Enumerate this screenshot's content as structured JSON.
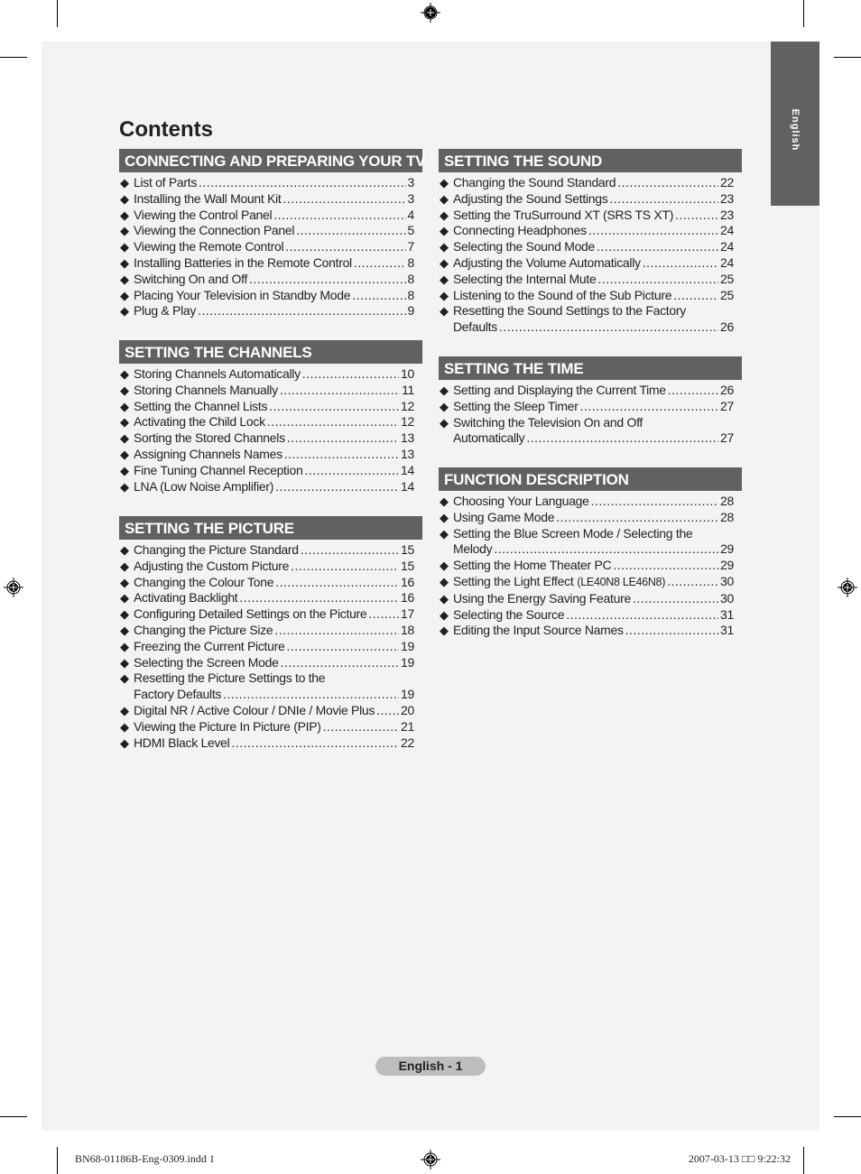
{
  "page": {
    "title": "Contents",
    "language_tab": "English",
    "footer_page_label": "English - 1",
    "slug_left": "BN68-01186B-Eng-0309.indd   1",
    "slug_right": "2007-03-13   □□ 9:22:32"
  },
  "icons": {
    "bullet": "◆",
    "registration_mark": "crosshair-target"
  },
  "colors": {
    "header_bar": "#636061",
    "page_bg": "#f3f3f3",
    "footer_pill": "#bdbdbd",
    "text": "#231f20"
  },
  "left_column": [
    {
      "heading": "CONNECTING AND PREPARING YOUR TV",
      "items": [
        {
          "lines": [
            "List of Parts"
          ],
          "page": "3"
        },
        {
          "lines": [
            "Installing the Wall Mount Kit"
          ],
          "page": "3"
        },
        {
          "lines": [
            "Viewing the Control Panel"
          ],
          "page": "4"
        },
        {
          "lines": [
            "Viewing the Connection Panel"
          ],
          "page": "5"
        },
        {
          "lines": [
            "Viewing the Remote Control"
          ],
          "page": "7"
        },
        {
          "lines": [
            "Installing Batteries in the Remote Control"
          ],
          "page": "8"
        },
        {
          "lines": [
            "Switching On and Off"
          ],
          "page": "8"
        },
        {
          "lines": [
            "Placing Your Television in Standby Mode"
          ],
          "page": "8"
        },
        {
          "lines": [
            "Plug & Play"
          ],
          "page": "9"
        }
      ]
    },
    {
      "heading": "SETTING THE CHANNELS",
      "items": [
        {
          "lines": [
            "Storing Channels Automatically"
          ],
          "page": "10"
        },
        {
          "lines": [
            "Storing Channels Manually"
          ],
          "page": "11"
        },
        {
          "lines": [
            "Setting the Channel Lists"
          ],
          "page": "12"
        },
        {
          "lines": [
            "Activating the Child Lock"
          ],
          "page": "12"
        },
        {
          "lines": [
            "Sorting the Stored Channels"
          ],
          "page": "13"
        },
        {
          "lines": [
            "Assigning Channels Names"
          ],
          "page": "13"
        },
        {
          "lines": [
            "Fine Tuning Channel Reception"
          ],
          "page": "14"
        },
        {
          "lines": [
            "LNA (Low Noise Amplifier)"
          ],
          "page": "14"
        }
      ]
    },
    {
      "heading": "SETTING THE PICTURE",
      "items": [
        {
          "lines": [
            "Changing the Picture Standard"
          ],
          "page": "15"
        },
        {
          "lines": [
            "Adjusting the Custom Picture"
          ],
          "page": "15"
        },
        {
          "lines": [
            "Changing the Colour Tone"
          ],
          "page": "16"
        },
        {
          "lines": [
            "Activating Backlight"
          ],
          "page": "16"
        },
        {
          "lines": [
            "Configuring Detailed Settings on the Picture"
          ],
          "page": "17"
        },
        {
          "lines": [
            "Changing the Picture Size"
          ],
          "page": "18"
        },
        {
          "lines": [
            "Freezing the Current Picture"
          ],
          "page": "19"
        },
        {
          "lines": [
            "Selecting the Screen Mode"
          ],
          "page": "19"
        },
        {
          "lines": [
            "Resetting the Picture Settings to the",
            "Factory Defaults"
          ],
          "page": "19"
        },
        {
          "lines": [
            "Digital NR / Active Colour / DNIe / Movie Plus"
          ],
          "page": "20"
        },
        {
          "lines": [
            "Viewing the Picture In Picture (PIP)"
          ],
          "page": "21"
        },
        {
          "lines": [
            "HDMI Black Level"
          ],
          "page": "22"
        }
      ]
    }
  ],
  "right_column": [
    {
      "heading": "SETTING THE SOUND",
      "items": [
        {
          "lines": [
            "Changing the Sound Standard"
          ],
          "page": "22"
        },
        {
          "lines": [
            "Adjusting the Sound Settings"
          ],
          "page": "23"
        },
        {
          "lines": [
            "Setting the TruSurround XT (SRS TS XT)"
          ],
          "page": "23"
        },
        {
          "lines": [
            "Connecting Headphones"
          ],
          "page": "24"
        },
        {
          "lines": [
            "Selecting the Sound Mode"
          ],
          "page": "24"
        },
        {
          "lines": [
            "Adjusting the Volume Automatically"
          ],
          "page": "24"
        },
        {
          "lines": [
            "Selecting the Internal Mute"
          ],
          "page": "25"
        },
        {
          "lines": [
            "Listening to the Sound of the Sub Picture"
          ],
          "page": "25"
        },
        {
          "lines": [
            "Resetting the Sound Settings to the Factory",
            "Defaults"
          ],
          "page": "26"
        }
      ]
    },
    {
      "heading": "SETTING THE TIME",
      "items": [
        {
          "lines": [
            "Setting and Displaying the Current Time"
          ],
          "page": "26"
        },
        {
          "lines": [
            "Setting the Sleep Timer"
          ],
          "page": "27"
        },
        {
          "lines": [
            "Switching the Television On and Off",
            "Automatically"
          ],
          "page": "27"
        }
      ]
    },
    {
      "heading": "FUNCTION DESCRIPTION",
      "items": [
        {
          "lines": [
            "Choosing Your Language"
          ],
          "page": "28"
        },
        {
          "lines": [
            "Using Game Mode"
          ],
          "page": "28"
        },
        {
          "lines": [
            "Setting the Blue Screen Mode / Selecting the",
            "Melody"
          ],
          "page": "29"
        },
        {
          "lines": [
            "Setting the Home Theater PC"
          ],
          "page": "29"
        },
        {
          "lines": [
            "Setting the Light Effect"
          ],
          "suffix": "(LE40N8  LE46N8)",
          "page": "30"
        },
        {
          "lines": [
            "Using the Energy Saving Feature"
          ],
          "page": "30"
        },
        {
          "lines": [
            "Selecting the Source"
          ],
          "page": "31"
        },
        {
          "lines": [
            "Editing the Input Source Names"
          ],
          "page": "31"
        }
      ]
    }
  ]
}
